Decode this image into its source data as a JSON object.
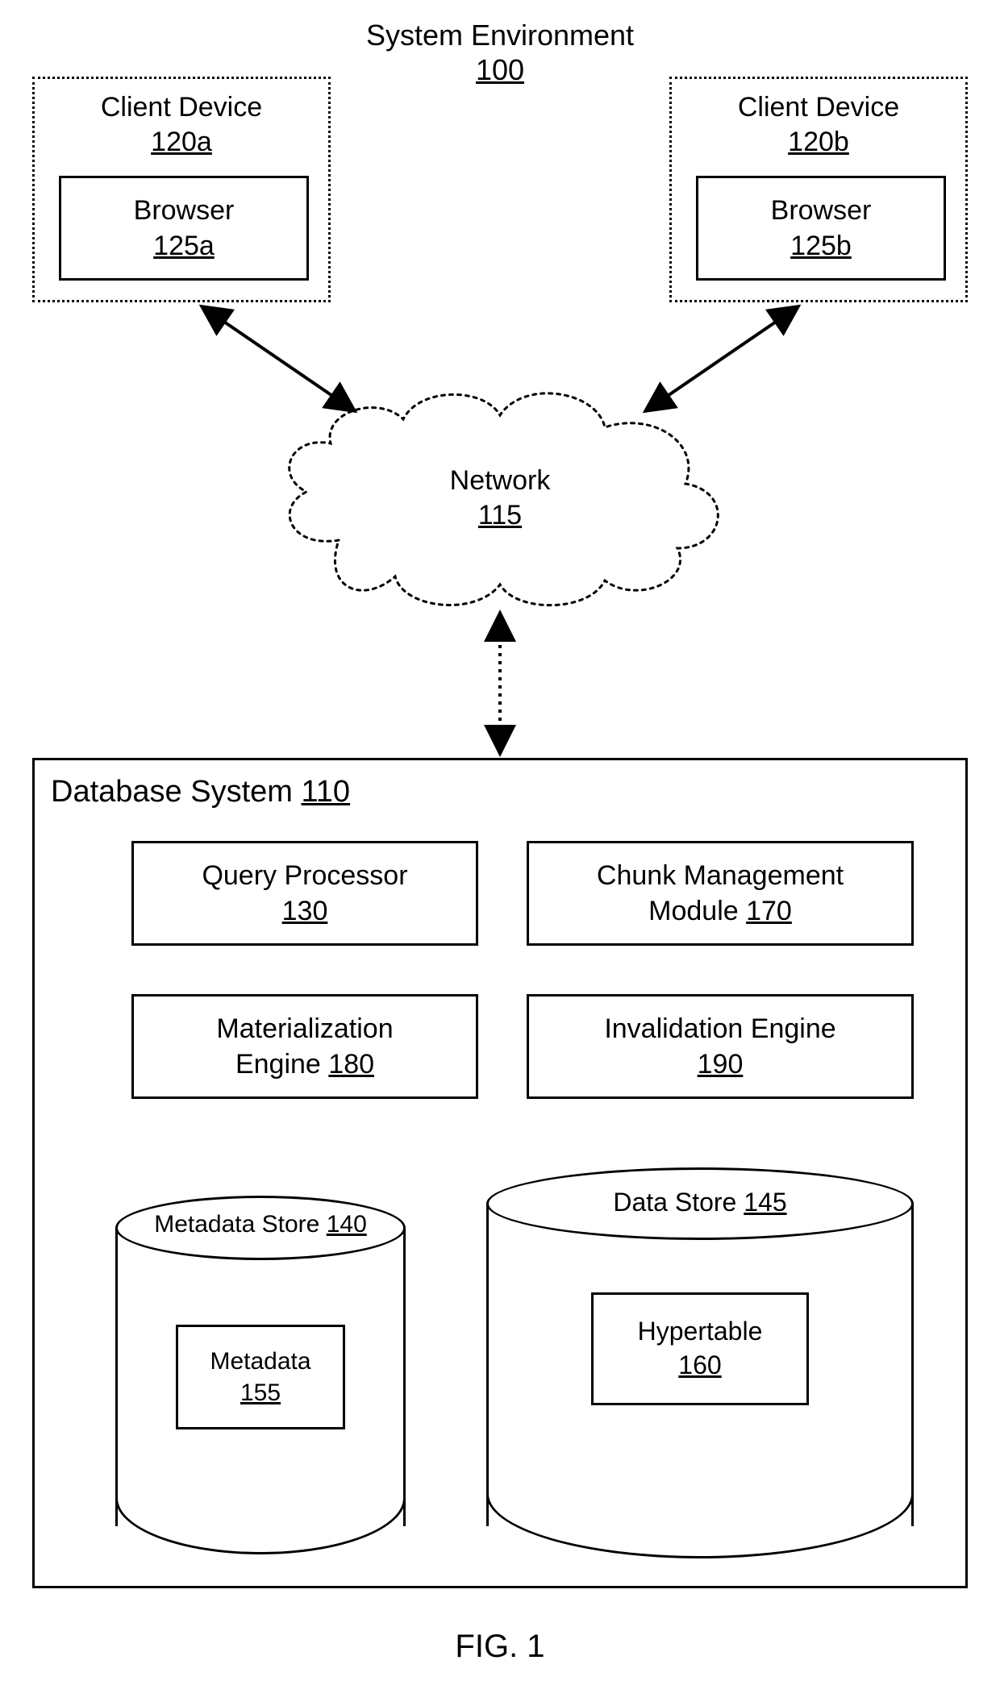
{
  "title": {
    "text": "System Environment",
    "ref": "100"
  },
  "clients": [
    {
      "title": "Client Device",
      "ref": "120a",
      "browser": {
        "title": "Browser",
        "ref": "125a"
      }
    },
    {
      "title": "Client Device",
      "ref": "120b",
      "browser": {
        "title": "Browser",
        "ref": "125b"
      }
    }
  ],
  "network": {
    "title": "Network",
    "ref": "115"
  },
  "database": {
    "heading": "Database System",
    "ref": "110",
    "modules": [
      {
        "title": "Query Processor",
        "ref": "130"
      },
      {
        "title_line1": "Chunk Management",
        "title_line2": "Module",
        "ref": "170"
      },
      {
        "title_line1": "Materialization",
        "title_line2": "Engine",
        "ref": "180"
      },
      {
        "title": "Invalidation Engine",
        "ref": "190"
      }
    ],
    "stores": [
      {
        "title": "Metadata Store",
        "ref": "140",
        "inner": {
          "title": "Metadata",
          "ref": "155"
        }
      },
      {
        "title": "Data Store",
        "ref": "145",
        "inner": {
          "title": "Hypertable",
          "ref": "160"
        }
      }
    ]
  },
  "figure_label": "FIG. 1"
}
